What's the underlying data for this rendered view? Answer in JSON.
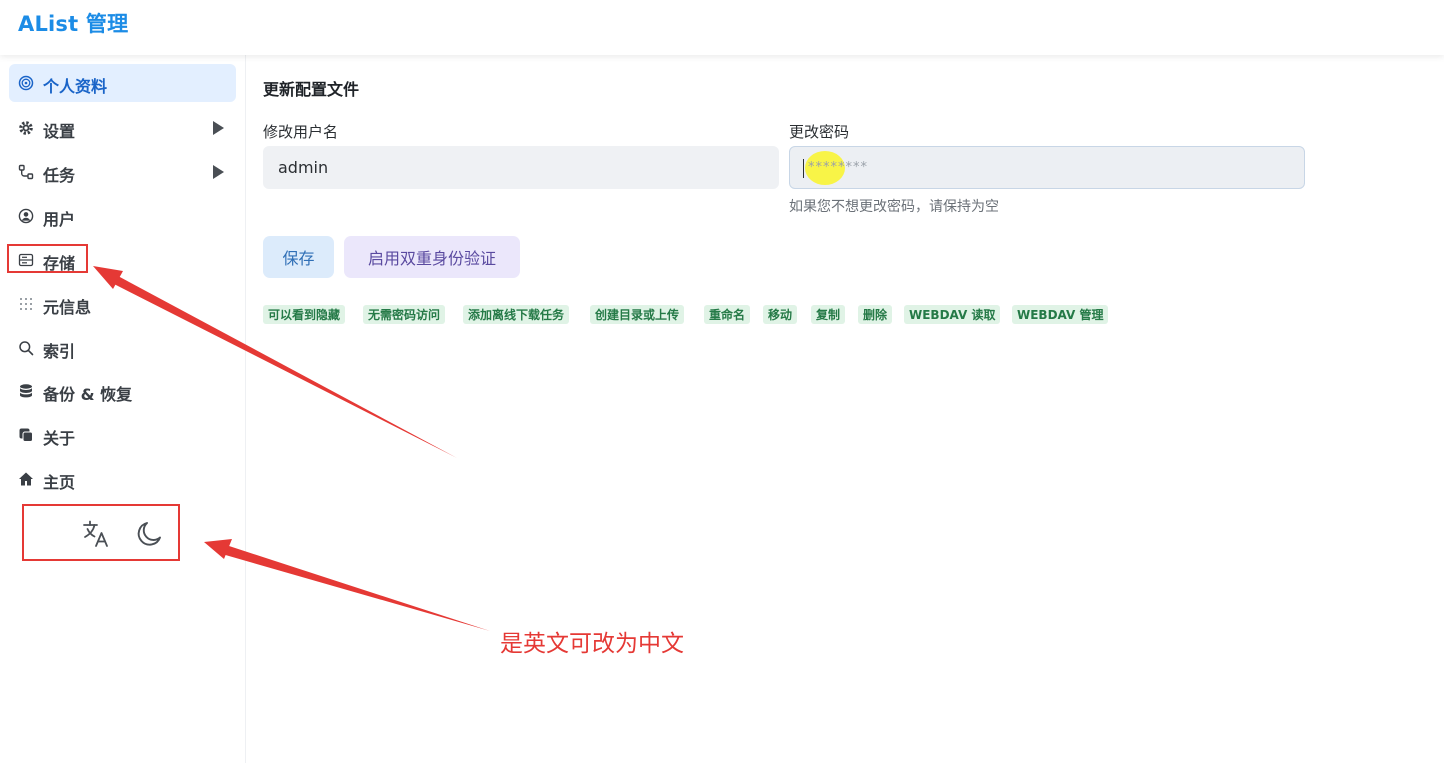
{
  "header": {
    "title": "AList 管理"
  },
  "sidebar": {
    "items": [
      {
        "label": "个人资料",
        "icon": "fingerprint-icon",
        "active": true,
        "expandable": false
      },
      {
        "label": "设置",
        "icon": "gear-icon",
        "active": false,
        "expandable": true
      },
      {
        "label": "任务",
        "icon": "workflow-icon",
        "active": false,
        "expandable": true
      },
      {
        "label": "用户",
        "icon": "user-circle-icon",
        "active": false,
        "expandable": false
      },
      {
        "label": "存储",
        "icon": "storage-icon",
        "active": false,
        "expandable": false
      },
      {
        "label": "元信息",
        "icon": "grid-icon",
        "active": false,
        "expandable": false
      },
      {
        "label": "索引",
        "icon": "search-icon",
        "active": false,
        "expandable": false
      },
      {
        "label": "备份 & 恢复",
        "icon": "database-icon",
        "active": false,
        "expandable": false
      },
      {
        "label": "关于",
        "icon": "copy-icon",
        "active": false,
        "expandable": false
      },
      {
        "label": "主页",
        "icon": "home-icon",
        "active": false,
        "expandable": false
      }
    ],
    "controls": [
      {
        "icon": "translate-icon"
      },
      {
        "icon": "moon-icon"
      }
    ]
  },
  "main": {
    "title": "更新配置文件",
    "username": {
      "label": "修改用户名",
      "value": "admin"
    },
    "password": {
      "label": "更改密码",
      "placeholder": "********",
      "hint": "如果您不想更改密码，请保持为空"
    },
    "buttons": {
      "save": "保存",
      "enable_2fa": "启用双重身份验证"
    },
    "permissions": [
      "可以看到隐藏",
      "无需密码访问",
      "添加离线下载任务",
      "创建目录或上传",
      "重命名",
      "移动",
      "复制",
      "删除",
      "WEBDAV 读取",
      "WEBDAV 管理"
    ]
  },
  "annotation": {
    "text": "是英文可改为中文"
  },
  "colors": {
    "accent": "#1c8ce6",
    "annotation": "#e53935",
    "tag_bg": "#e0f3e6",
    "tag_text": "#257a47"
  }
}
